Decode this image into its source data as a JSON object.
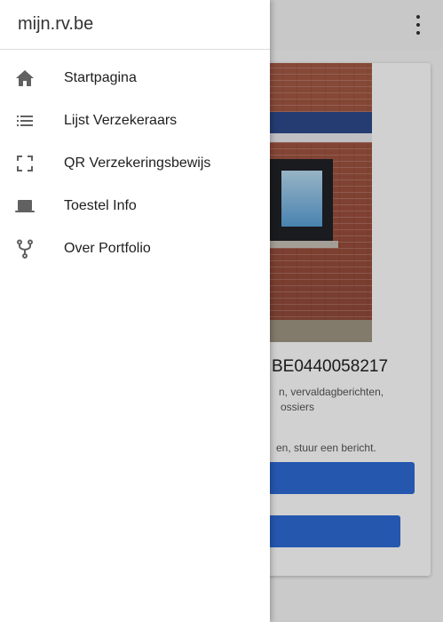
{
  "app": {
    "title": "mijn.rv.be"
  },
  "drawer": {
    "items": [
      {
        "label": "Startpagina",
        "icon": "home-icon"
      },
      {
        "label": "Lijst Verzekeraars",
        "icon": "list-icon"
      },
      {
        "label": "QR Verzekeringsbewijs",
        "icon": "qr-scan-icon"
      },
      {
        "label": "Toestel Info",
        "icon": "laptop-icon"
      },
      {
        "label": "Over Portfolio",
        "icon": "fork-icon"
      }
    ]
  },
  "background": {
    "card_title": "BE0440058217",
    "card_text_line1": "n, vervaldagberichten,",
    "card_text_line2": "ossiers",
    "card_text_line3": "en, stuur een bericht."
  },
  "colors": {
    "primary_button": "#2e6bd6",
    "drawer_bg": "#ffffff",
    "appbar_bg": "#f5f5f5"
  }
}
